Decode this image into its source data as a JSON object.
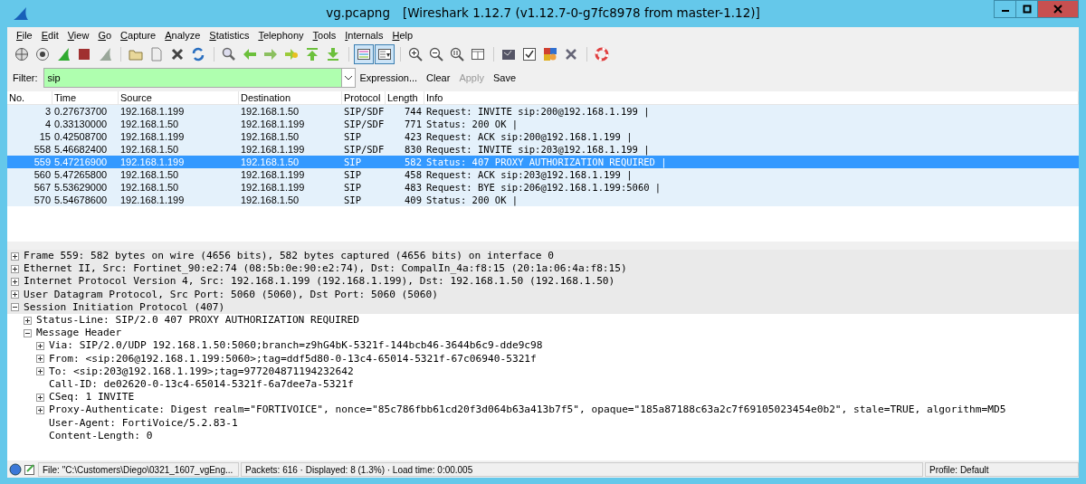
{
  "window": {
    "title": "vg.pcapng",
    "subtitle": "[Wireshark 1.12.7  (v1.12.7-0-g7fc8978 from master-1.12)]"
  },
  "menu": [
    "File",
    "Edit",
    "View",
    "Go",
    "Capture",
    "Analyze",
    "Statistics",
    "Telephony",
    "Tools",
    "Internals",
    "Help"
  ],
  "toolbar": {
    "colorize": {
      "pressed": true
    },
    "auto_scroll": {
      "pressed": true
    }
  },
  "filter": {
    "label": "Filter:",
    "value": "sip",
    "valid": true,
    "buttons": [
      {
        "label": "Expression...",
        "disabled": false
      },
      {
        "label": "Clear",
        "disabled": false
      },
      {
        "label": "Apply",
        "disabled": true
      },
      {
        "label": "Save",
        "disabled": false
      }
    ]
  },
  "packet_list": {
    "columns": [
      "No.",
      "Time",
      "Source",
      "Destination",
      "Protocol",
      "Length",
      "Info"
    ],
    "rows": [
      {
        "cells": [
          "3",
          "0.27673700",
          "192.168.1.199",
          "192.168.1.50",
          "SIP/SDF",
          "744",
          "Request: INVITE sip:200@192.168.1.199 |"
        ],
        "selected": false
      },
      {
        "cells": [
          "4",
          "0.33130000",
          "192.168.1.50",
          "192.168.1.199",
          "SIP/SDF",
          "771",
          "Status: 200 OK |"
        ],
        "selected": false
      },
      {
        "cells": [
          "15",
          "0.42508700",
          "192.168.1.199",
          "192.168.1.50",
          "SIP",
          "423",
          "Request: ACK sip:200@192.168.1.199 |"
        ],
        "selected": false
      },
      {
        "cells": [
          "558",
          "5.46682400",
          "192.168.1.50",
          "192.168.1.199",
          "SIP/SDF",
          "830",
          "Request: INVITE sip:203@192.168.1.199 |"
        ],
        "selected": false
      },
      {
        "cells": [
          "559",
          "5.47216900",
          "192.168.1.199",
          "192.168.1.50",
          "SIP",
          "582",
          "Status: 407 PROXY AUTHORIZATION REQUIRED |"
        ],
        "selected": true
      },
      {
        "cells": [
          "560",
          "5.47265800",
          "192.168.1.50",
          "192.168.1.199",
          "SIP",
          "458",
          "Request: ACK sip:203@192.168.1.199 |"
        ],
        "selected": false
      },
      {
        "cells": [
          "567",
          "5.53629000",
          "192.168.1.50",
          "192.168.1.199",
          "SIP",
          "483",
          "Request: BYE sip:206@192.168.1.199:5060 |"
        ],
        "selected": false
      },
      {
        "cells": [
          "570",
          "5.54678600",
          "192.168.1.199",
          "192.168.1.50",
          "SIP",
          "409",
          "Status: 200 OK |"
        ],
        "selected": false
      }
    ]
  },
  "packet_details": [
    {
      "text": "Frame 559: 582 bytes on wire (4656 bits), 582 bytes captured (4656 bits) on interface 0",
      "expanded": false
    },
    {
      "text": "Ethernet II, Src: Fortinet_90:e2:74 (08:5b:0e:90:e2:74), Dst: CompalIn_4a:f8:15 (20:1a:06:4a:f8:15)",
      "expanded": false
    },
    {
      "text": "Internet Protocol Version 4, Src: 192.168.1.199 (192.168.1.199), Dst: 192.168.1.50 (192.168.1.50)",
      "expanded": false
    },
    {
      "text": "User Datagram Protocol, Src Port: 5060 (5060), Dst Port: 5060 (5060)",
      "expanded": false
    },
    {
      "text": "Session Initiation Protocol (407)",
      "expanded": true,
      "children": [
        {
          "text": "Status-Line: SIP/2.0 407 PROXY AUTHORIZATION REQUIRED",
          "expanded": false
        },
        {
          "text": "Message Header",
          "expanded": true,
          "children": [
            {
              "text": "Via: SIP/2.0/UDP 192.168.1.50:5060;branch=z9hG4bK-5321f-144bcb46-3644b6c9-dde9c98",
              "expanded": false
            },
            {
              "text": "From: <sip:206@192.168.1.199:5060>;tag=ddf5d80-0-13c4-65014-5321f-67c06940-5321f",
              "expanded": false
            },
            {
              "text": "To: <sip:203@192.168.1.199>;tag=977204871194232642",
              "expanded": false
            },
            {
              "text": "Call-ID: de02620-0-13c4-65014-5321f-6a7dee7a-5321f",
              "kind": "leaf"
            },
            {
              "text": "CSeq: 1 INVITE",
              "expanded": false
            },
            {
              "text": "Proxy-Authenticate: Digest realm=\"FORTIVOICE\", nonce=\"85c786fbb61cd20f3d064b63a413b7f5\", opaque=\"185a87188c63a2c7f69105023454e0b2\", stale=TRUE, algorithm=MD5",
              "expanded": false
            },
            {
              "text": "User-Agent: FortiVoice/5.2.83-1",
              "kind": "leaf"
            },
            {
              "text": "Content-Length: 0",
              "kind": "leaf"
            }
          ]
        }
      ]
    }
  ],
  "status_bar": {
    "file": "File: \"C:\\Customers\\Diego\\0321_1607_vgEng...",
    "packets": "Packets: 616 · Displayed: 8 (1.3%) · Load time: 0:00.005",
    "profile": "Profile: Default"
  }
}
